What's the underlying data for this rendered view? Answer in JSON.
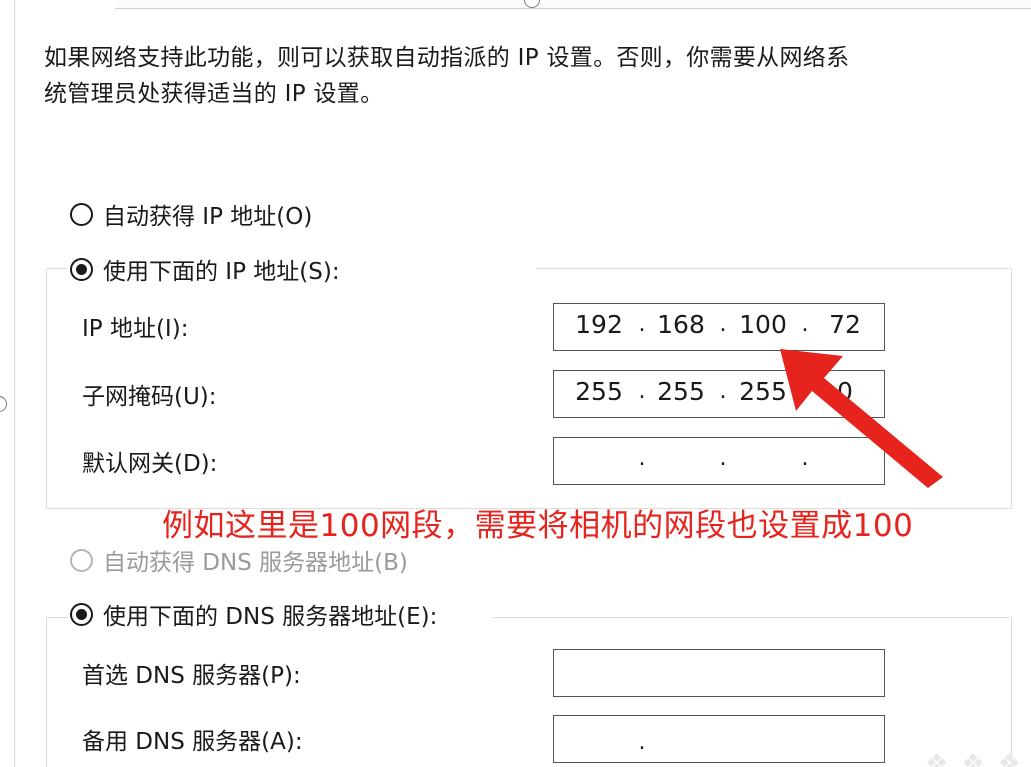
{
  "description": {
    "line1": "如果网络支持此功能，则可以获取自动指派的 IP 设置。否则，你需要从网络系",
    "line2": "统管理员处获得适当的 IP 设置。"
  },
  "ip_mode": {
    "auto_label": "自动获得 IP 地址(O)",
    "manual_label": "使用下面的 IP 地址(S):",
    "selected": "manual"
  },
  "ip_fields": {
    "ip_address": {
      "label": "IP 地址(I):",
      "octets": [
        "192",
        "168",
        "100",
        "72"
      ]
    },
    "subnet_mask": {
      "label": "子网掩码(U):",
      "octets": [
        "255",
        "255",
        "255",
        "0"
      ]
    },
    "gateway": {
      "label": "默认网关(D):",
      "octets": [
        "",
        "",
        "",
        ""
      ]
    }
  },
  "dns_mode": {
    "auto_label": "自动获得 DNS 服务器地址(B)",
    "manual_label": "使用下面的 DNS 服务器地址(E):",
    "selected": "manual"
  },
  "dns_fields": {
    "preferred": {
      "label": "首选 DNS 服务器(P):",
      "octets": [
        "",
        "",
        "",
        ""
      ]
    },
    "alternate": {
      "label": "备用 DNS 服务器(A):",
      "octets": [
        "",
        "",
        "",
        ""
      ]
    }
  },
  "annotation": {
    "text": "例如这里是100网段，需要将相机的网段也设置成100",
    "color": "#e6231c"
  },
  "colors": {
    "accent_red": "#e6231c",
    "disabled_text": "#9a9a9a"
  }
}
